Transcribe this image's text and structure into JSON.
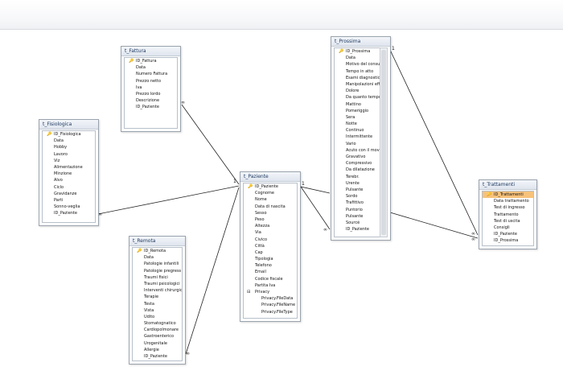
{
  "tables": {
    "fattura": {
      "title": "t_Fattura",
      "fields": [
        {
          "name": "ID_Fattura",
          "pk": true
        },
        {
          "name": "Data"
        },
        {
          "name": "Numero Fattura"
        },
        {
          "name": "Prezzo netto"
        },
        {
          "name": "Iva"
        },
        {
          "name": "Prezzo lordo"
        },
        {
          "name": "Descrizione"
        },
        {
          "name": "ID_Paziente"
        }
      ]
    },
    "fisiologica": {
      "title": "t_Fisiologica",
      "fields": [
        {
          "name": "ID_Fisiologica",
          "pk": true
        },
        {
          "name": "Data"
        },
        {
          "name": "Hobby"
        },
        {
          "name": "Lavoro"
        },
        {
          "name": "Viz"
        },
        {
          "name": "Alimentazione"
        },
        {
          "name": "Minzione"
        },
        {
          "name": "Alvo"
        },
        {
          "name": "Ciclo"
        },
        {
          "name": "Gravidanze"
        },
        {
          "name": "Parti"
        },
        {
          "name": "Sonno-veglia"
        },
        {
          "name": "ID_Paziente"
        }
      ]
    },
    "remota": {
      "title": "t_Remota",
      "fields": [
        {
          "name": "ID_Remota",
          "pk": true
        },
        {
          "name": "Data"
        },
        {
          "name": "Patologie infantili"
        },
        {
          "name": "Patologie pregress"
        },
        {
          "name": "Traumi fisici"
        },
        {
          "name": "Traumi psicologici"
        },
        {
          "name": "Interventi chirurgic"
        },
        {
          "name": "Terapie"
        },
        {
          "name": "Testa"
        },
        {
          "name": "Vista"
        },
        {
          "name": "Udito"
        },
        {
          "name": "Stomatognatico"
        },
        {
          "name": "Cardiopolmonare"
        },
        {
          "name": "Gastroenterico"
        },
        {
          "name": "Urogenitale"
        },
        {
          "name": "Allergie"
        },
        {
          "name": "ID_Paziente"
        }
      ]
    },
    "paziente": {
      "title": "t_Paziente",
      "fields": [
        {
          "name": "ID_Paziente",
          "pk": true
        },
        {
          "name": "Cognome"
        },
        {
          "name": "Nome"
        },
        {
          "name": "Data di nascita"
        },
        {
          "name": "Sesso"
        },
        {
          "name": "Peso"
        },
        {
          "name": "Altezza"
        },
        {
          "name": "Via"
        },
        {
          "name": "Civico"
        },
        {
          "name": "Città"
        },
        {
          "name": "Cap"
        },
        {
          "name": "Tipologia"
        },
        {
          "name": "Telefono"
        },
        {
          "name": "Email"
        },
        {
          "name": "Codice fiscale"
        },
        {
          "name": "Partita Iva"
        },
        {
          "name": "Privacy",
          "expand": true
        },
        {
          "name": "Privacy.FileData",
          "sub": true
        },
        {
          "name": "Privacy.FileName",
          "sub": true
        },
        {
          "name": "Privacy.FileType",
          "sub": true
        }
      ]
    },
    "prossima": {
      "title": "t_Prossima",
      "fields": [
        {
          "name": "ID_Prossima",
          "pk": true
        },
        {
          "name": "Data"
        },
        {
          "name": "Motivo del consult"
        },
        {
          "name": "Tempo in atto"
        },
        {
          "name": "Esami diagnostici"
        },
        {
          "name": "Manipolazioni effe"
        },
        {
          "name": "Dolore"
        },
        {
          "name": "Da quanto tempo?"
        },
        {
          "name": "Mattino"
        },
        {
          "name": "Pomeriggio"
        },
        {
          "name": "Sera"
        },
        {
          "name": "Notte"
        },
        {
          "name": "Continuo"
        },
        {
          "name": "Intermittente"
        },
        {
          "name": "Vario"
        },
        {
          "name": "Acuto con il movim"
        },
        {
          "name": "Gravativo"
        },
        {
          "name": "Compressivo"
        },
        {
          "name": "Da dilatazione"
        },
        {
          "name": "Terebr."
        },
        {
          "name": "Urente"
        },
        {
          "name": "Pulsante"
        },
        {
          "name": "Sordo"
        },
        {
          "name": "Trafittivo"
        },
        {
          "name": "Puntorio"
        },
        {
          "name": "Pulsante"
        },
        {
          "name": "Sourcé"
        },
        {
          "name": "ID_Paziente"
        }
      ]
    },
    "trattamenti": {
      "title": "t_Trattamenti",
      "fields": [
        {
          "name": "ID_Trattamenti",
          "pk": true,
          "selected": true
        },
        {
          "name": "Data trattamento"
        },
        {
          "name": "Test di ingresso"
        },
        {
          "name": "Trattamento"
        },
        {
          "name": "Test di uscita"
        },
        {
          "name": "Consigli"
        },
        {
          "name": "ID_Paziente"
        },
        {
          "name": "ID_Prossima"
        }
      ]
    }
  },
  "relations": {
    "one": "1",
    "many": "∞"
  },
  "icons": {
    "primary_key": "key-icon",
    "expand": "expand-toggle-icon"
  }
}
